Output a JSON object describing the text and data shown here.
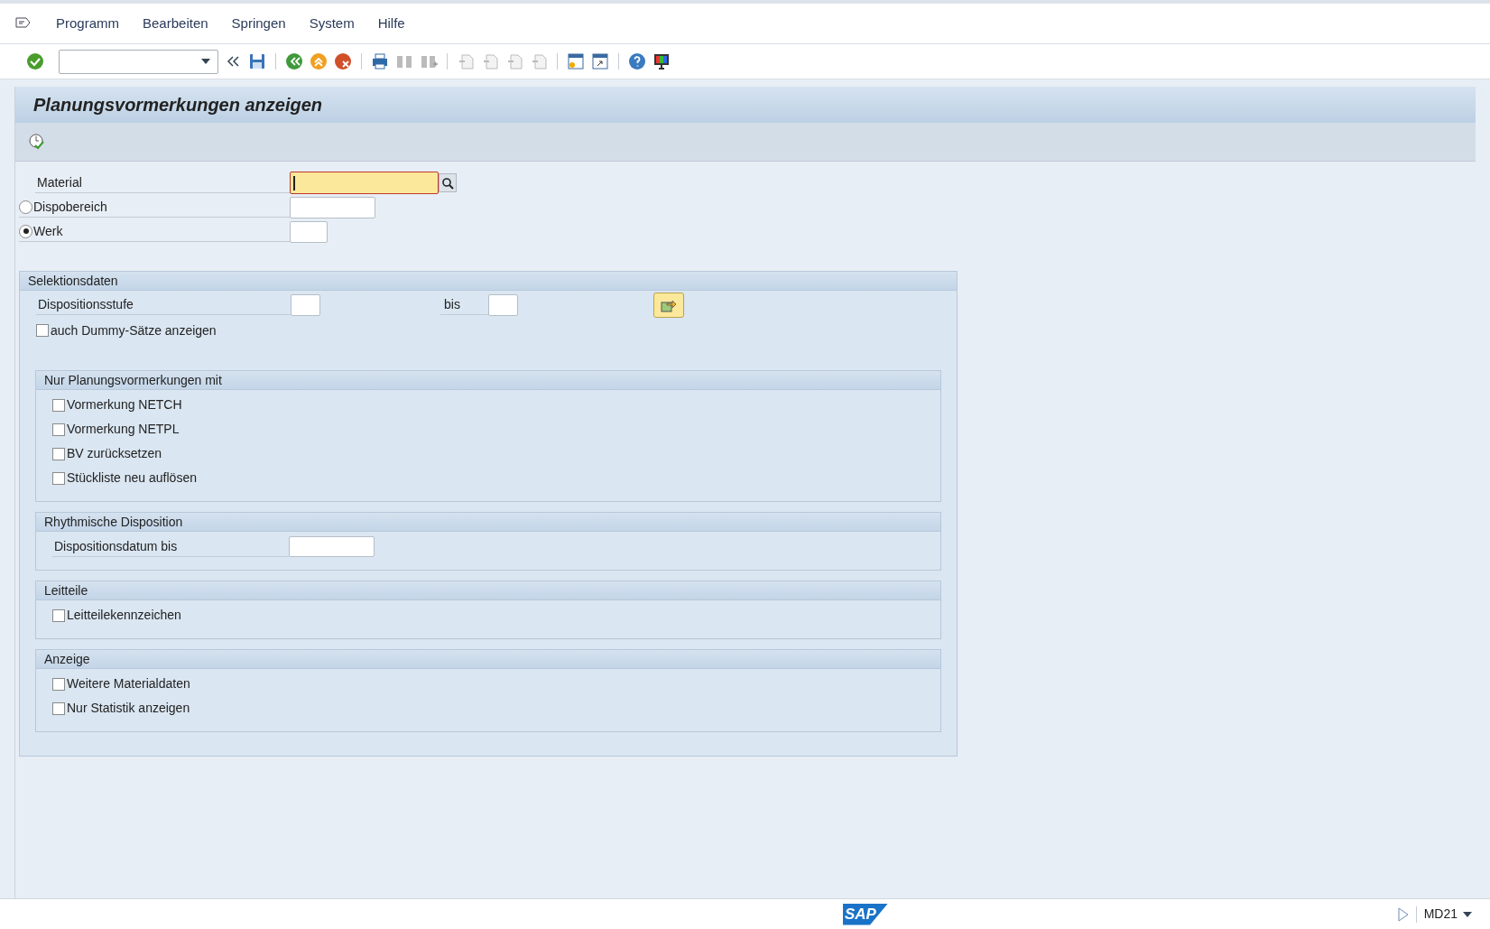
{
  "menu": [
    "Programm",
    "Bearbeiten",
    "Springen",
    "System",
    "Hilfe"
  ],
  "title": "Planungsvormerkungen anzeigen",
  "fields": [
    {
      "kind": "input",
      "label": "Material",
      "focused": true,
      "search": true
    },
    {
      "kind": "radio",
      "label": "Dispobereich",
      "selected": false
    },
    {
      "kind": "radio",
      "label": "Werk",
      "selected": true
    }
  ],
  "selection": {
    "title": "Selektionsdaten",
    "range_label": "Dispositionsstufe",
    "range_to": "bis",
    "dummy": {
      "label": "auch Dummy-Sätze anzeigen",
      "checked": false
    },
    "groups": [
      {
        "title": "Nur Planungsvormerkungen mit",
        "rows": [
          {
            "kind": "checkbox",
            "label": "Vormerkung NETCH",
            "checked": false
          },
          {
            "kind": "checkbox",
            "label": "Vormerkung NETPL",
            "checked": false
          },
          {
            "kind": "checkbox",
            "label": "BV zurücksetzen",
            "checked": false
          },
          {
            "kind": "checkbox",
            "label": "Stückliste neu auflösen",
            "checked": false
          }
        ]
      },
      {
        "title": "Rhythmische Disposition",
        "rows": [
          {
            "kind": "input",
            "label": "Dispositionsdatum bis"
          }
        ]
      },
      {
        "title": "Leitteile",
        "rows": [
          {
            "kind": "checkbox",
            "label": "Leitteilekennzeichen",
            "checked": false
          }
        ]
      },
      {
        "title": "Anzeige",
        "rows": [
          {
            "kind": "checkbox",
            "label": "Weitere Materialdaten",
            "checked": false
          },
          {
            "kind": "checkbox",
            "label": "Nur Statistik anzeigen",
            "checked": false
          }
        ]
      }
    ]
  },
  "status_bar": {
    "logo": "SAP",
    "transaction": "MD21"
  }
}
